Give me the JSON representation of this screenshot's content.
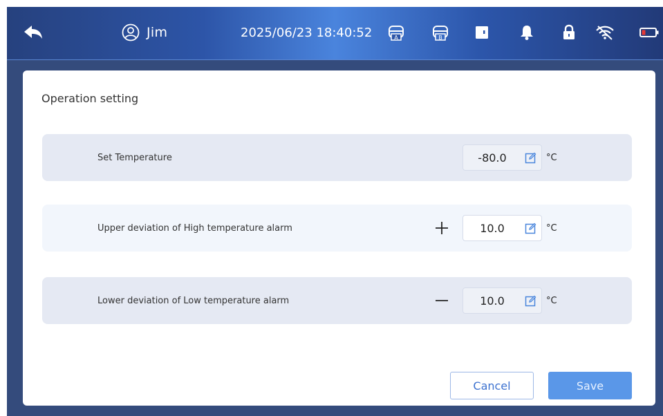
{
  "header": {
    "user_name": "Jim",
    "datetime": "2025/06/23 18:40:52",
    "status_icons": [
      "freezer-a-icon",
      "freezer-b-icon",
      "door-icon",
      "bell-icon",
      "lock-icon",
      "wifi-icon",
      "battery-icon"
    ],
    "battery_color": "#e53935"
  },
  "panel": {
    "title": "Operation setting",
    "rows": [
      {
        "label": "Set Temperature",
        "sign": "",
        "value": "-80.0",
        "unit": "°C"
      },
      {
        "label": "Upper deviation of High temperature alarm",
        "sign": "+",
        "value": "10.0",
        "unit": "°C"
      },
      {
        "label": "Lower deviation of Low temperature alarm",
        "sign": "−",
        "value": "10.0",
        "unit": "°C"
      }
    ],
    "cancel_label": "Cancel",
    "save_label": "Save"
  },
  "colors": {
    "accent": "#3d72d0",
    "save_button": "#5a97e8"
  }
}
